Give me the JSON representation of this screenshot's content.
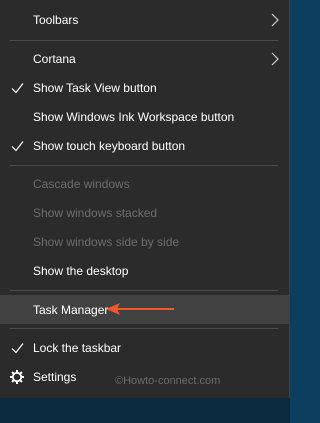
{
  "menu": {
    "items": [
      {
        "label": "Toolbars"
      },
      {
        "label": "Cortana"
      },
      {
        "label": "Show Task View button"
      },
      {
        "label": "Show Windows Ink Workspace button"
      },
      {
        "label": "Show touch keyboard button"
      },
      {
        "label": "Cascade windows"
      },
      {
        "label": "Show windows stacked"
      },
      {
        "label": "Show windows side by side"
      },
      {
        "label": "Show the desktop"
      },
      {
        "label": "Task Manager"
      },
      {
        "label": "Lock the taskbar"
      },
      {
        "label": "Settings"
      }
    ]
  },
  "watermark": "©Howto-connect.com",
  "colors": {
    "menu_background": "#2b2b2b",
    "hover_background": "#414141",
    "disabled_text": "#6d6d6d",
    "arrow": "#f05a28",
    "desktop": "#0b3a59"
  },
  "icons": {
    "submenu": "chevron-right-icon",
    "checked": "check-icon",
    "settings": "gear-icon",
    "annotation": "arrow-left-icon"
  }
}
